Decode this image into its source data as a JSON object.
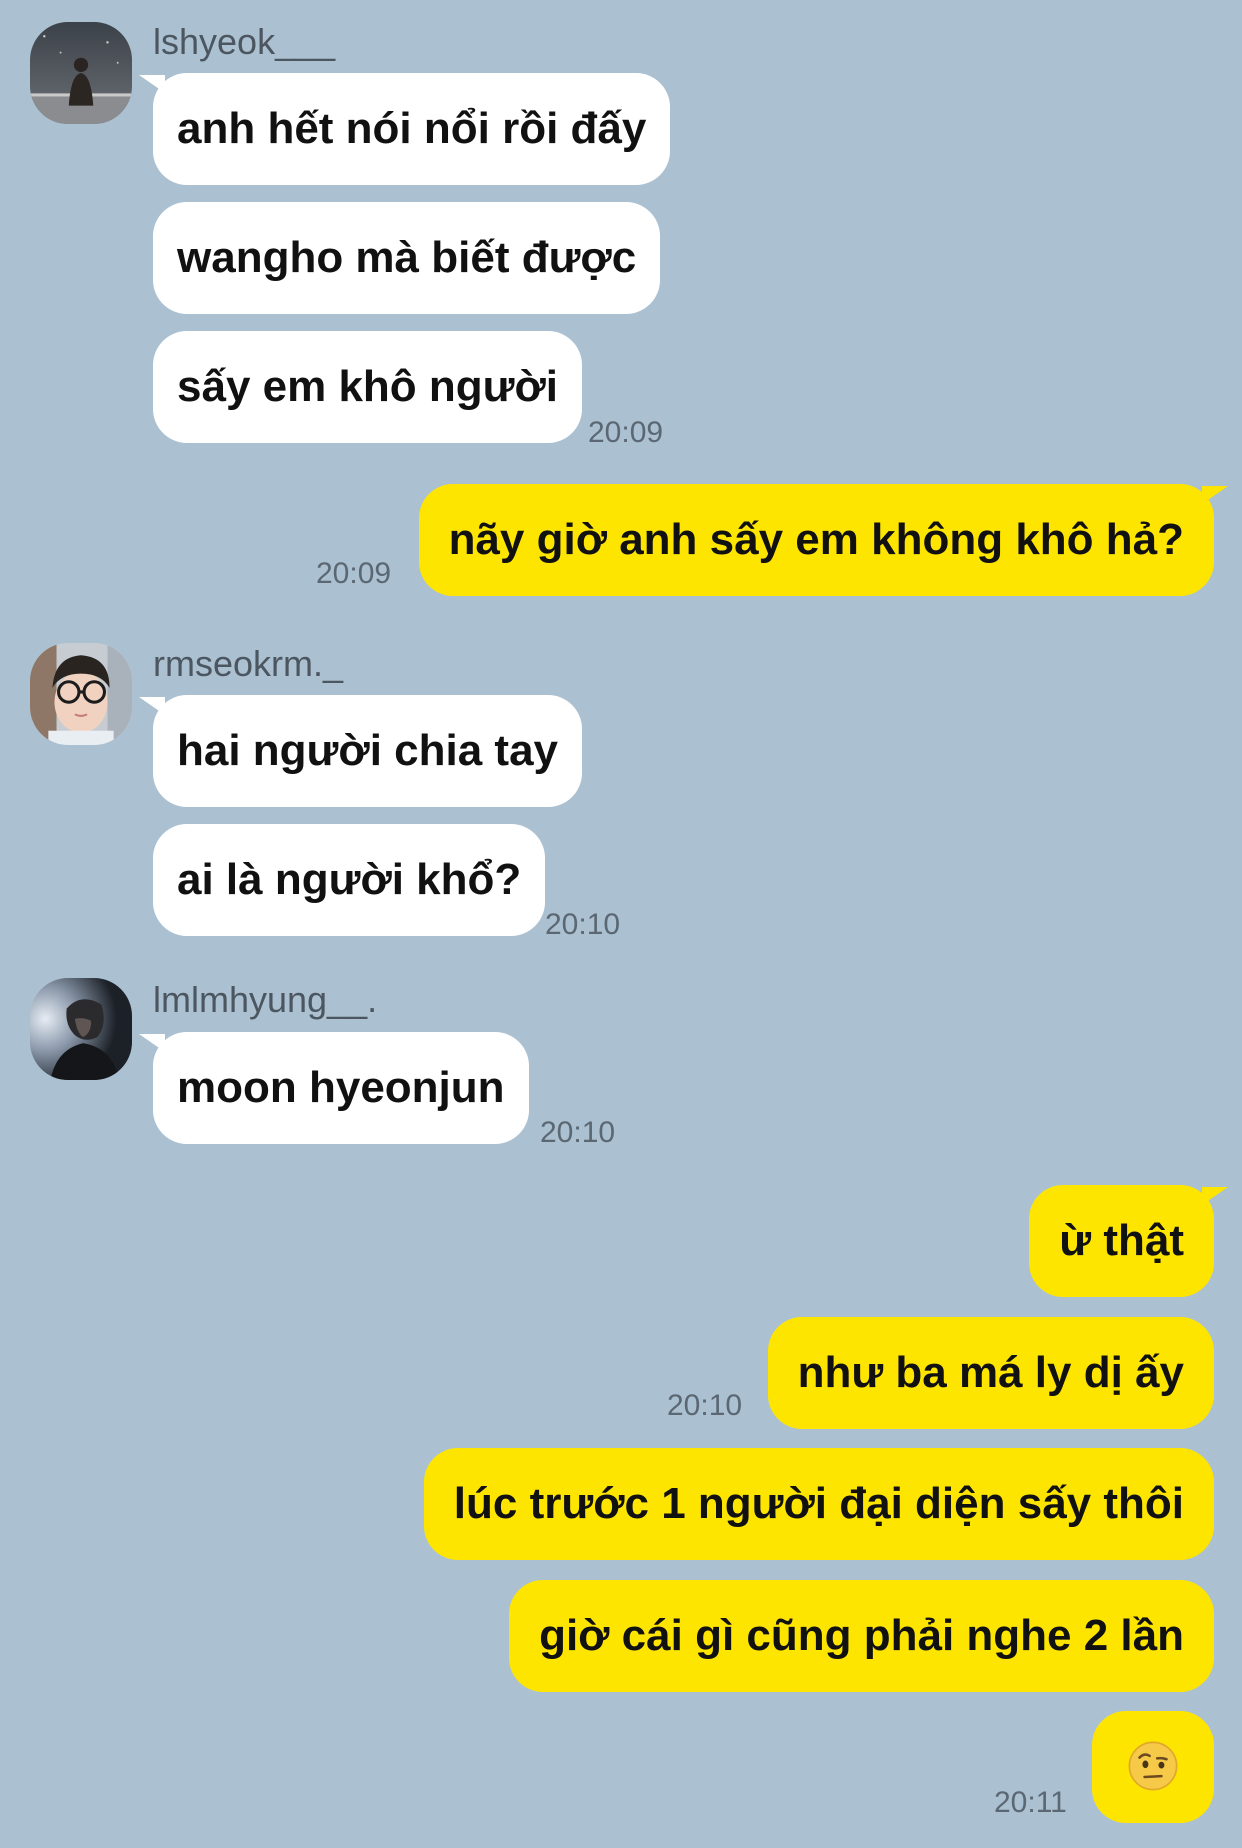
{
  "colors": {
    "background": "#abc1d1",
    "incoming_bubble": "#ffffff",
    "outgoing_bubble": "#fee500",
    "timestamp": "#5b6873",
    "sender_name": "#4c5660"
  },
  "groups": [
    {
      "sender": "lshyeok___",
      "avatar_icon": "avatar-photo-icon",
      "messages": [
        "anh hết nói nổi rồi đấy",
        "wangho mà biết được",
        "sấy em khô người"
      ],
      "time": "20:09"
    },
    {
      "outgoing": true,
      "messages": [
        "nãy giờ anh sấy em không khô hả?"
      ],
      "time": "20:09"
    },
    {
      "sender": "rmseokrm._",
      "avatar_icon": "avatar-photo-icon",
      "messages": [
        "hai người chia tay",
        "ai là người khổ?"
      ],
      "time": "20:10"
    },
    {
      "sender": "lmlmhyung__.",
      "avatar_icon": "avatar-photo-icon",
      "messages": [
        "moon hyeonjun"
      ],
      "time": "20:10"
    },
    {
      "outgoing": true,
      "messages": [
        "ừ thật",
        "như ba má ly dị ấy"
      ],
      "time": "20:10"
    },
    {
      "outgoing": true,
      "messages": [
        "lúc trước 1 người đại diện sấy thôi",
        "giờ cái gì cũng phải nghe 2 lần"
      ]
    },
    {
      "outgoing": true,
      "emoji": "face-with-raised-eyebrow-icon",
      "time": "20:11"
    }
  ]
}
